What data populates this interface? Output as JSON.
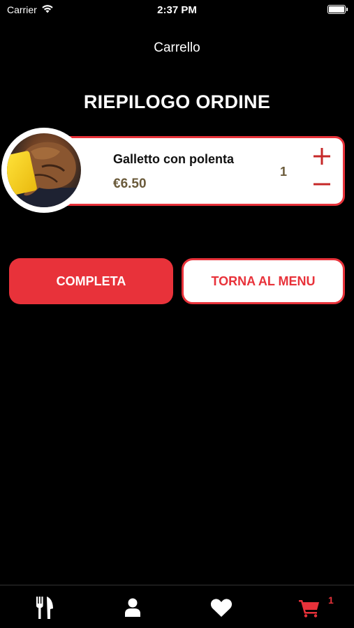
{
  "status_bar": {
    "carrier": "Carrier",
    "time": "2:37 PM"
  },
  "nav": {
    "title": "Carrello"
  },
  "summary": {
    "title": "RIEPILOGO ORDINE"
  },
  "cart_items": [
    {
      "name": "Galletto con polenta",
      "price": "€6.50",
      "quantity": "1",
      "image_icon": "galletto-photo"
    }
  ],
  "actions": {
    "complete_label": "COMPLETA",
    "back_label": "TORNA AL MENU"
  },
  "tab_bar": {
    "items": [
      {
        "icon": "fork-knife-icon",
        "active": false
      },
      {
        "icon": "user-icon",
        "active": false
      },
      {
        "icon": "heart-icon",
        "active": false
      },
      {
        "icon": "cart-icon",
        "active": true
      }
    ],
    "cart_badge": "1"
  },
  "colors": {
    "accent": "#e8323a",
    "price": "#6a5a3a",
    "background": "#000000"
  }
}
